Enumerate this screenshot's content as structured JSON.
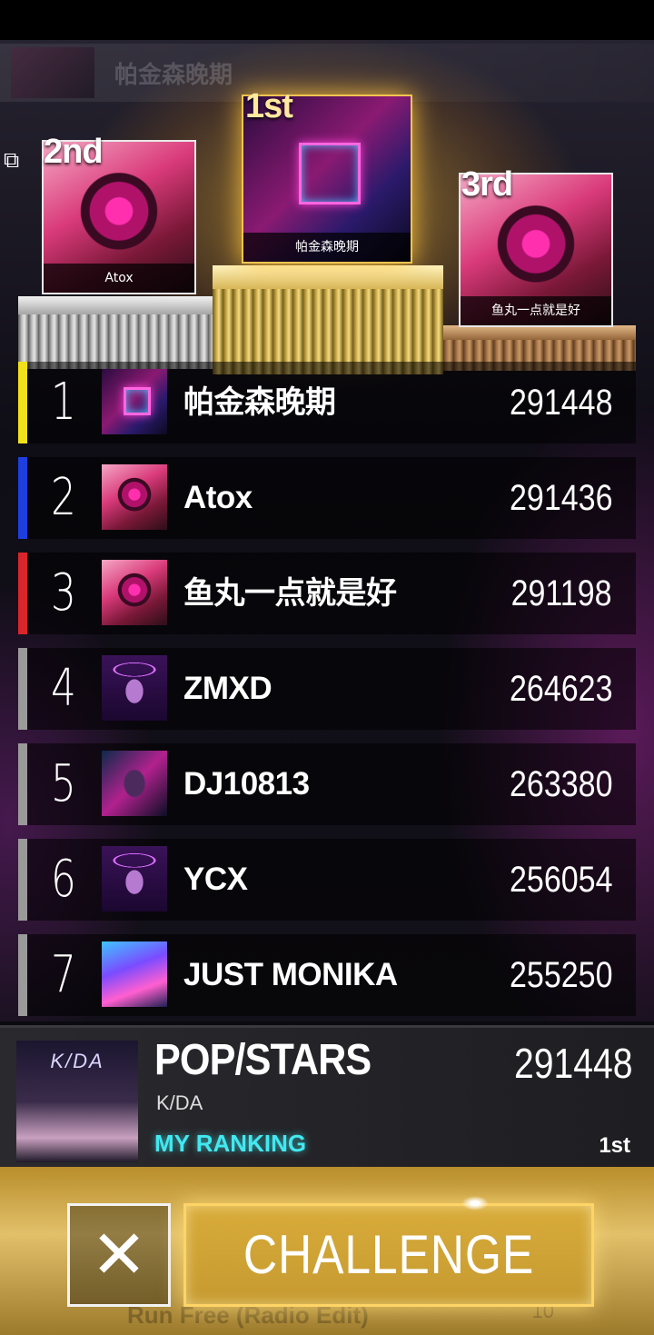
{
  "header": {
    "ghost_title": "帕金森晚期"
  },
  "podium": [
    {
      "rank_label": "1st",
      "name": "帕金森晚期"
    },
    {
      "rank_label": "2nd",
      "name": "Atox"
    },
    {
      "rank_label": "3rd",
      "name": "鱼丸一点就是好"
    }
  ],
  "leaderboard": [
    {
      "rank": "1",
      "name": "帕金森晚期",
      "score": "291448",
      "bar_color": "#f2e11a",
      "avatar": "neon-room"
    },
    {
      "rank": "2",
      "name": "Atox",
      "score": "291436",
      "bar_color": "#1e3fe0",
      "avatar": "heart-helmet"
    },
    {
      "rank": "3",
      "name": "鱼丸一点就是好",
      "score": "291198",
      "bar_color": "#d9262b",
      "avatar": "heart-helmet"
    },
    {
      "rank": "4",
      "name": "ZMXD",
      "score": "264623",
      "bar_color": "#9a9a9a",
      "avatar": "neon-bust"
    },
    {
      "rank": "5",
      "name": "DJ10813",
      "score": "263380",
      "bar_color": "#9a9a9a",
      "avatar": "cyber-face"
    },
    {
      "rank": "6",
      "name": "YCX",
      "score": "256054",
      "bar_color": "#9a9a9a",
      "avatar": "neon-bust"
    },
    {
      "rank": "7",
      "name": "JUST MONIKA",
      "score": "255250",
      "bar_color": "#9a9a9a",
      "avatar": "neon-city"
    }
  ],
  "song": {
    "cover_text": "K/DA",
    "title": "POP/STARS",
    "artist": "K/DA",
    "score": "291448",
    "my_ranking_label": "MY RANKING",
    "rank": "1st"
  },
  "actions": {
    "close_icon": "close-icon",
    "challenge_label": "CHALLENGE"
  },
  "background_next": {
    "title": "Run Free (Radio Edit)",
    "count": "10"
  },
  "colors": {
    "accent_gold": "#f3c451",
    "my_ranking": "#42e8f0"
  }
}
